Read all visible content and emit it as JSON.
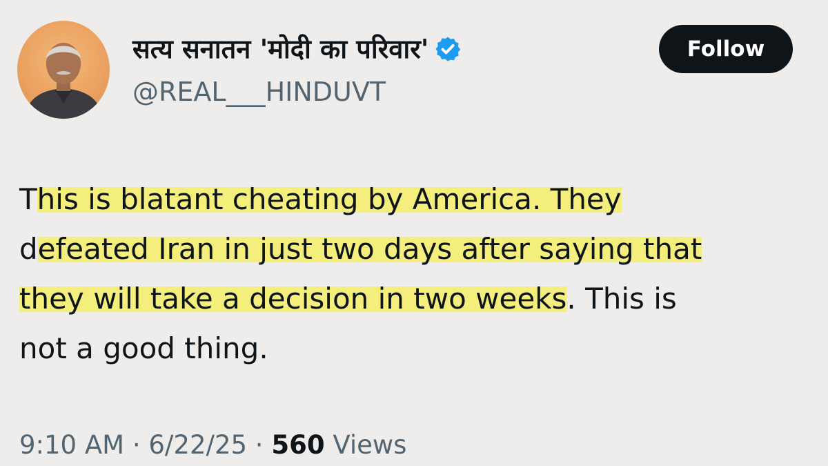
{
  "author": {
    "display_name": "सत्य सनातन 'मोदी का परिवार'",
    "handle": "@REAL___HINDUVT",
    "verified_icon": "verified-badge-icon",
    "verified_color": "#1d9bf0"
  },
  "follow_button": {
    "label": "Follow"
  },
  "tweet": {
    "lines": [
      {
        "plain": "T",
        "highlight": "his is blatant cheating by America. They",
        "rest": ""
      },
      {
        "plain": "d",
        "highlight": "efeated Iran in just two days after saying that",
        "rest": ""
      },
      {
        "plain": "",
        "highlight": "they will take a decision in two weeks",
        "rest": ". This is"
      },
      {
        "plain": "not a good thing.",
        "highlight": "",
        "rest": ""
      }
    ]
  },
  "meta": {
    "time": "9:10 AM",
    "separator": " · ",
    "date": "6/22/25",
    "views_count": "560",
    "views_label": " Views"
  },
  "colors": {
    "background": "#eeedec",
    "highlight": "#f4ee7d",
    "text": "#0f1419",
    "muted": "#536471",
    "button": "#0f1419"
  }
}
